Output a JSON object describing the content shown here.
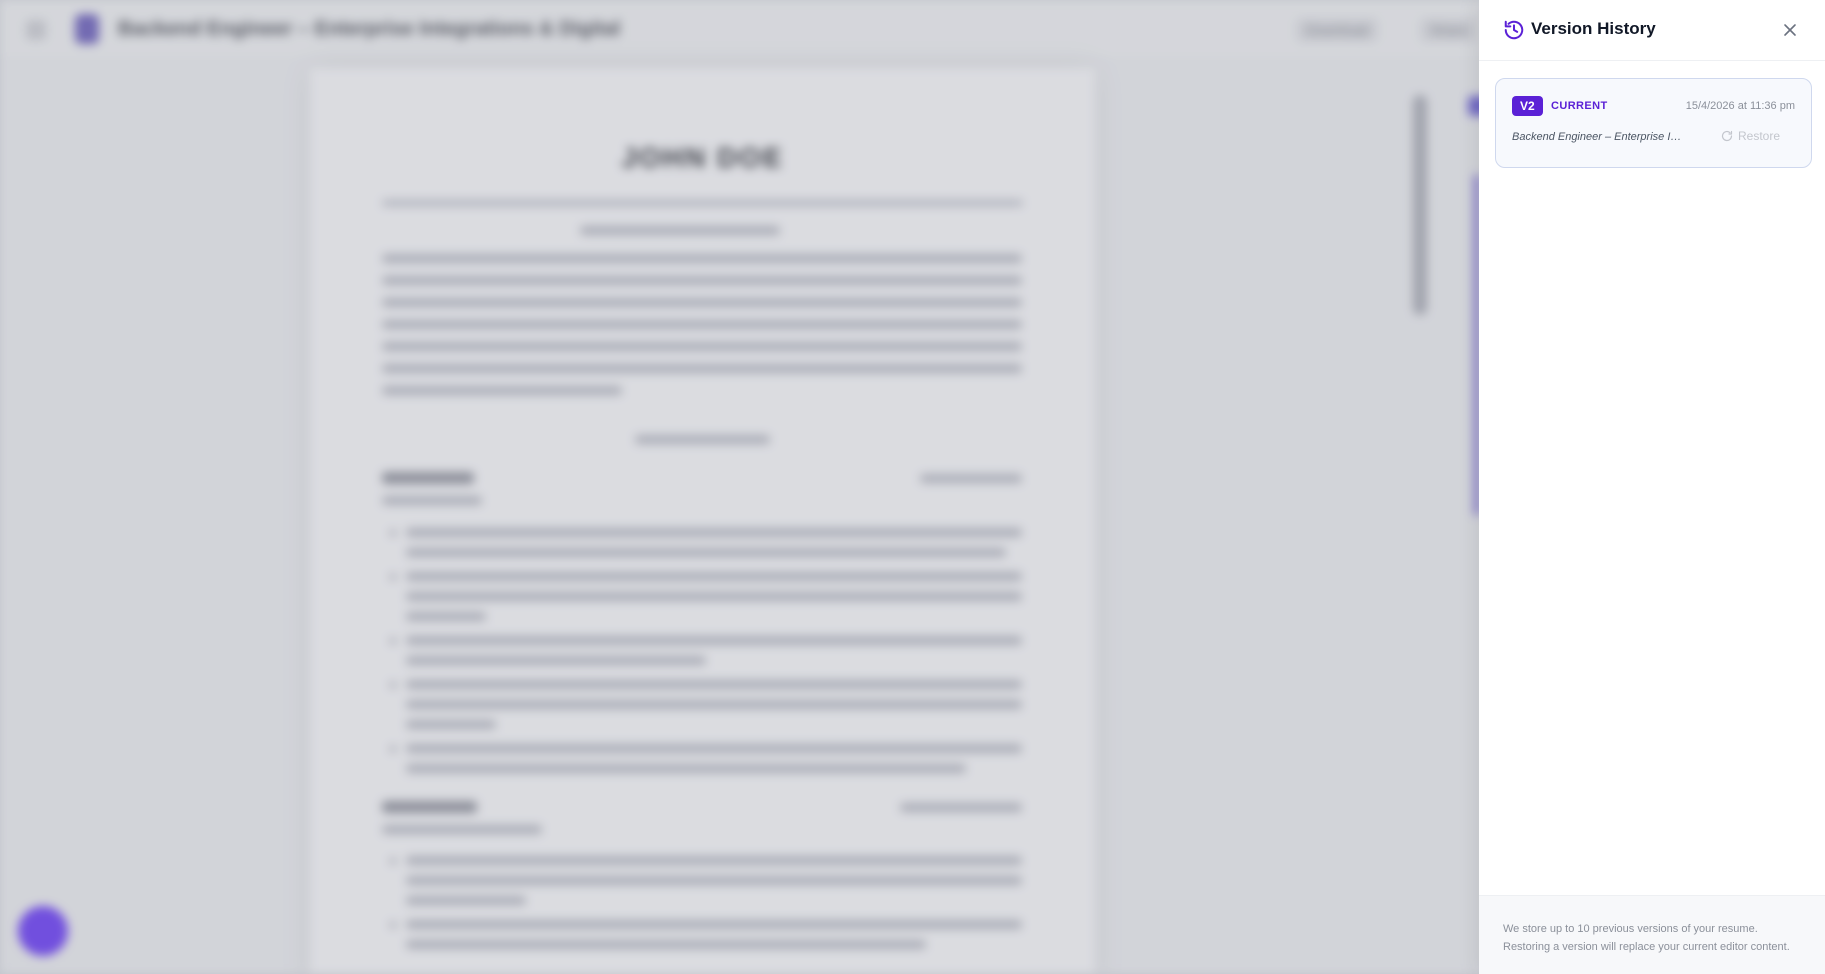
{
  "background": {
    "app_title": "Backend Engineer – Enterprise Integrations & Digital",
    "toolbar_btn_1": "Download",
    "toolbar_btn_2": "Share",
    "resume_name": "JOHN DOE"
  },
  "panel": {
    "title": "Version History",
    "icons": {
      "title": "history-icon",
      "close": "close-icon",
      "restore": "refresh-icon"
    },
    "versions": [
      {
        "badge": "V2",
        "status": "CURRENT",
        "timestamp": "15/4/2026 at 11:36 pm",
        "description": "Backend Engineer – Enterprise Integrations & Digital",
        "restore_label": "Restore"
      }
    ],
    "footer": {
      "line1": "We store up to 10 previous versions of your resume.",
      "line2": "Restoring a version will replace your current editor content."
    }
  },
  "colors": {
    "accent": "#5b21d6",
    "card_border": "#cfd8ee",
    "muted": "#8b909a"
  }
}
